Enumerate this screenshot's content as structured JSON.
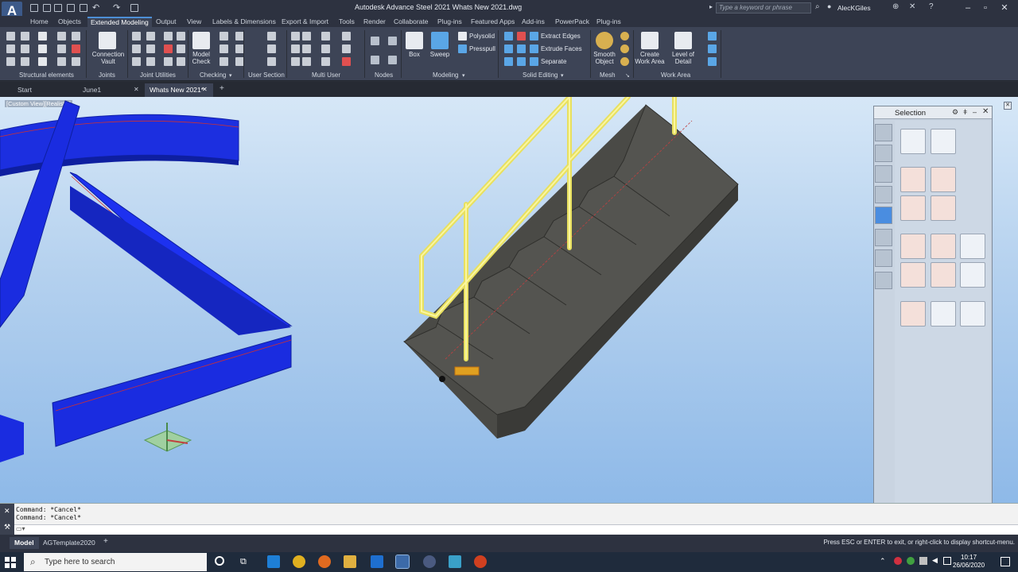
{
  "window": {
    "title": "Autodesk Advance Steel 2021    Whats New 2021.dwg",
    "search_placeholder": "Type a keyword or phrase",
    "user": "AlecKGiles",
    "logo": "A"
  },
  "ribbon_tabs": [
    "Home",
    "Objects",
    "Extended Modeling",
    "Output",
    "View",
    "Labels & Dimensions",
    "Export & Import",
    "Tools",
    "Render",
    "Collaborate",
    "Plug-ins",
    "Featured Apps",
    "Add-ins",
    "PowerPack",
    "Plug-ins"
  ],
  "ribbon_panels": {
    "structural_elements": "Structural elements",
    "joints": "Joints",
    "joint_utilities": "Joint Utilities",
    "checking": "Checking",
    "user_section": "User Section",
    "multi_user": "Multi User",
    "nodes": "Nodes",
    "modeling": "Modeling",
    "solid_editing": "Solid Editing",
    "mesh": "Mesh",
    "work_area": "Work Area"
  },
  "ribbon_buttons": {
    "connection_vault": "Connection\nVault",
    "model_check": "Model\nCheck",
    "box": "Box",
    "sweep": "Sweep",
    "polysolid": "Polysolid",
    "presspull": "Presspull",
    "extract_edges": "Extract Edges",
    "extrude_faces": "Extrude Faces",
    "separate": "Separate",
    "smooth_object": "Smooth\nObject",
    "create_work_area": "Create\nWork Area",
    "level_of_detail": "Level of\nDetail"
  },
  "doc_tabs": [
    "Start",
    "June1",
    "Whats New 2021*"
  ],
  "viewport_label": "[Custom View][Realistic]",
  "palette": {
    "title": "Selection"
  },
  "command_history": [
    "Command: *Cancel*",
    "Command: *Cancel*"
  ],
  "layout_tabs": [
    "Model",
    "AGTemplate2020"
  ],
  "status_message": "Press ESC or ENTER to exit, or right-click to display shortcut-menu.",
  "taskbar": {
    "search_placeholder": "Type here to search",
    "time": "10:17",
    "date": "26/06/2020"
  }
}
